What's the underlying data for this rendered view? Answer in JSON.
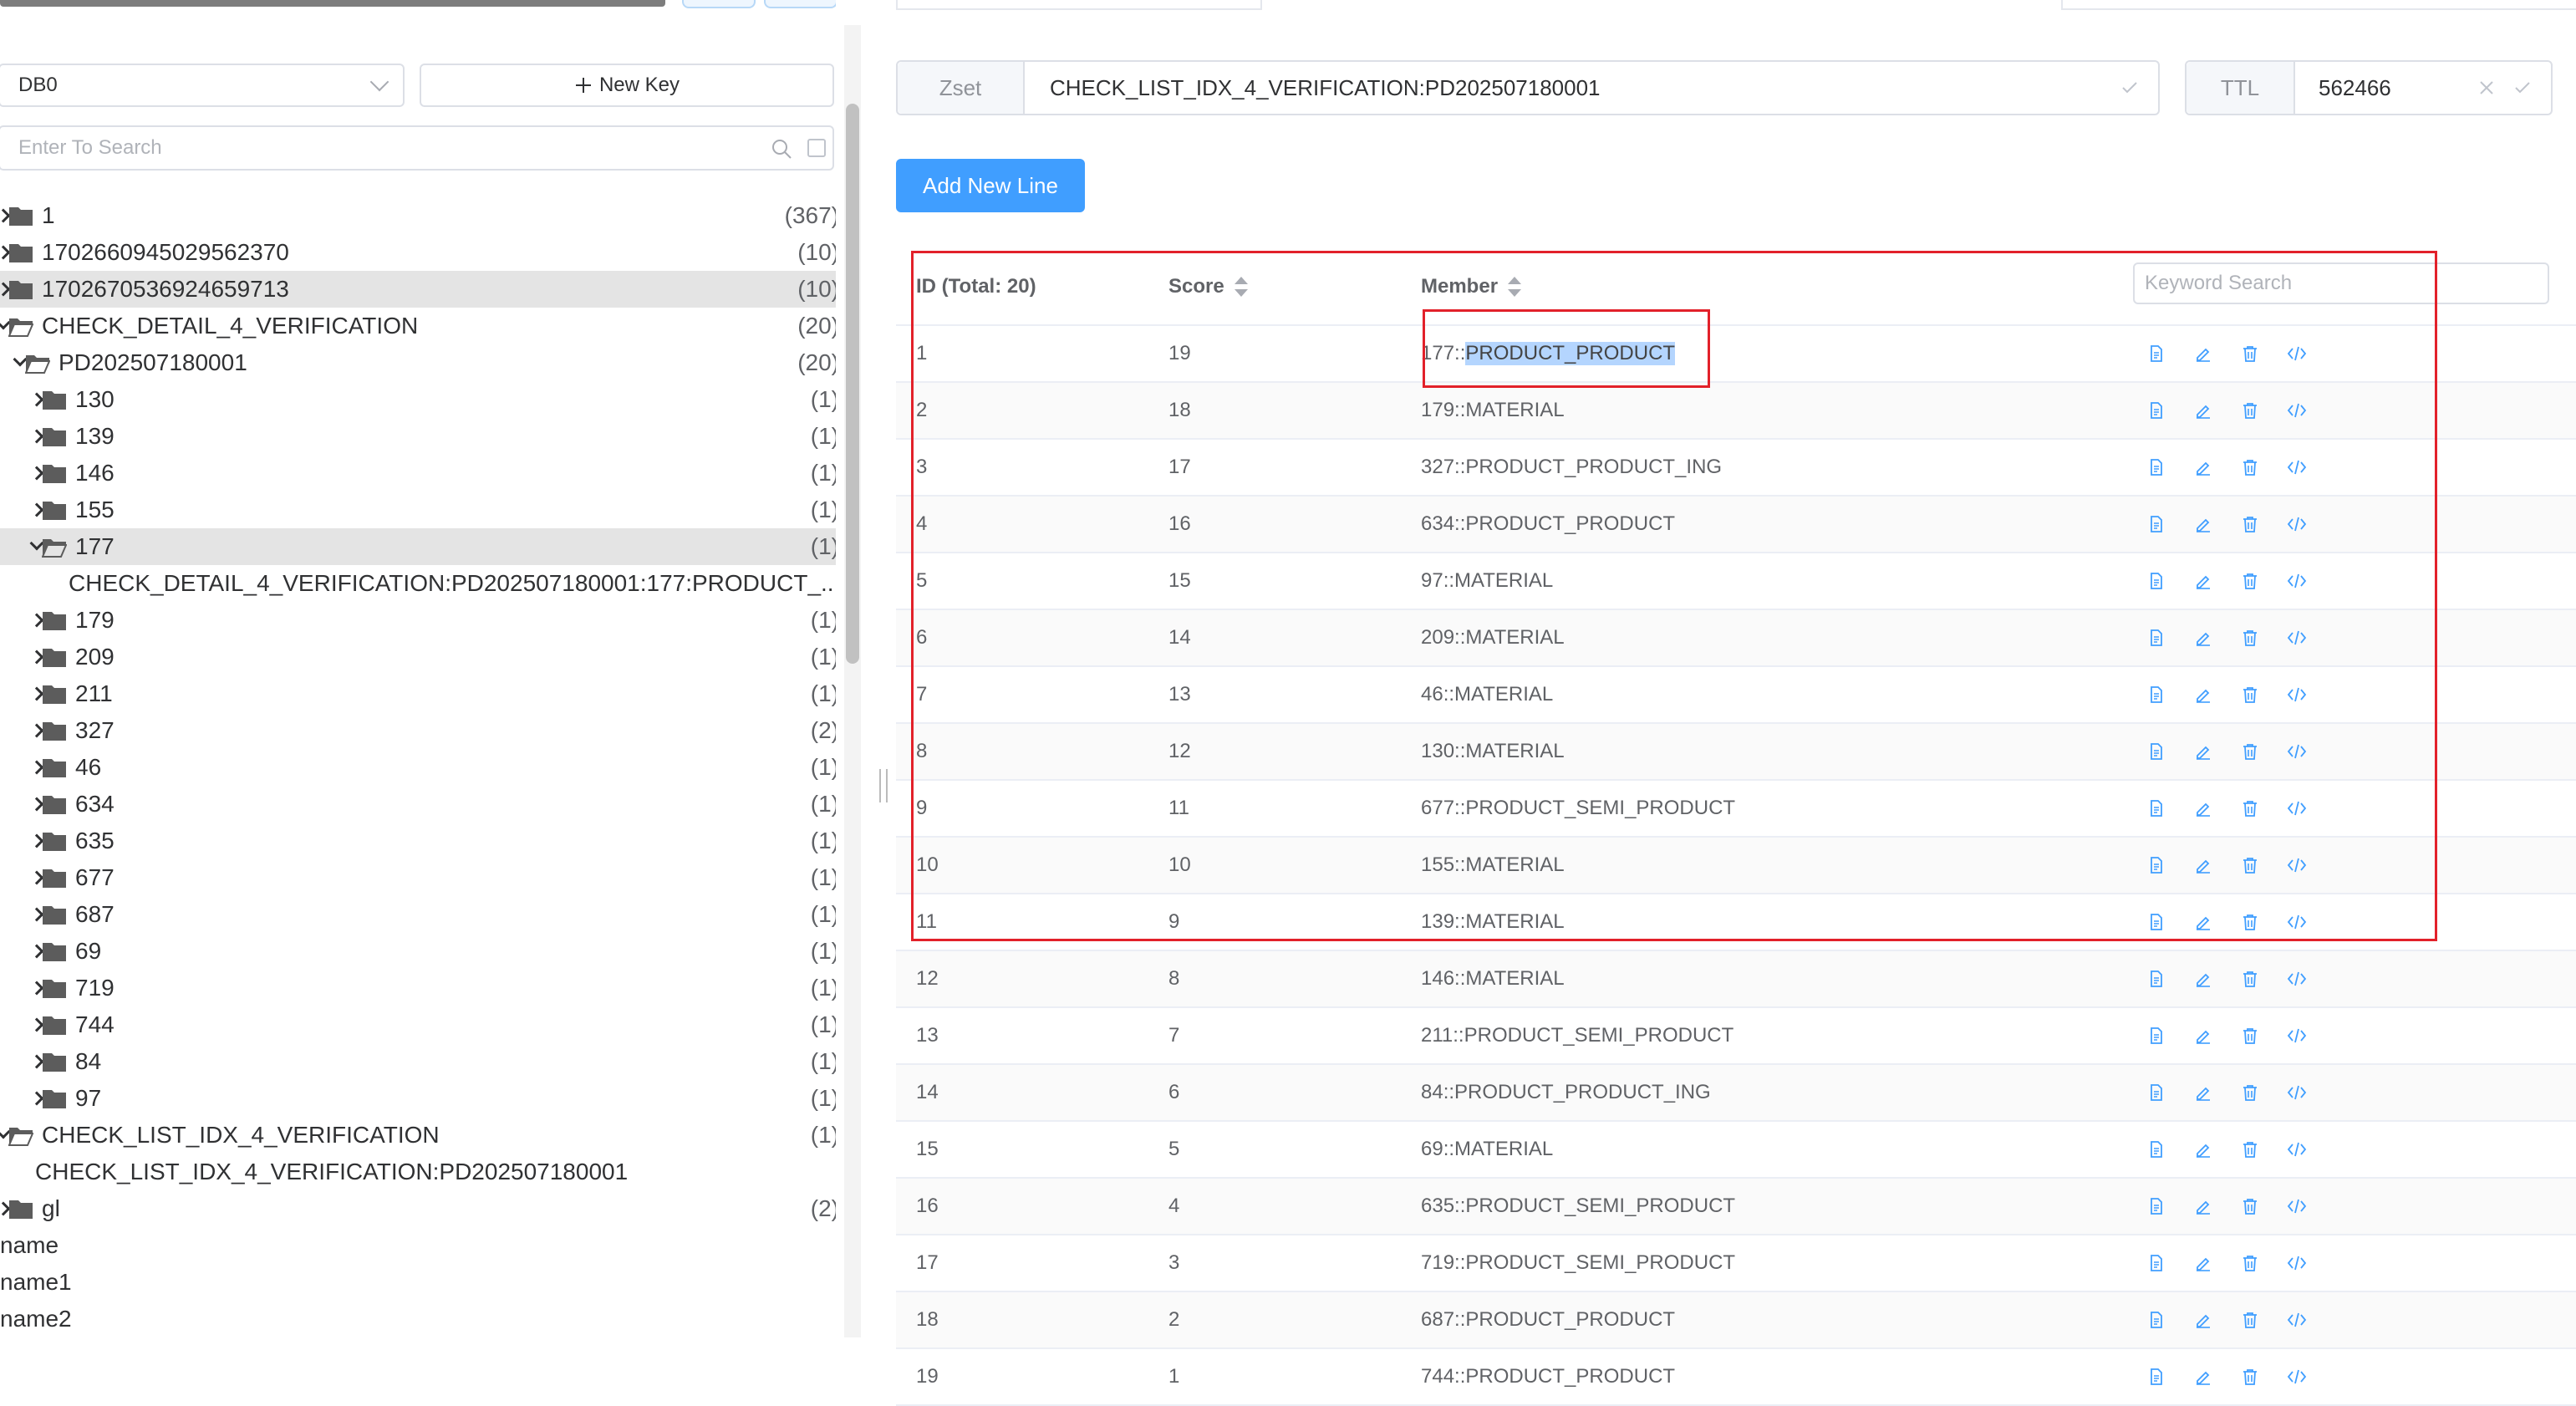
{
  "sidebar": {
    "db_select": "DB0",
    "new_key_label": "New Key",
    "search_placeholder": "Enter To Search",
    "tree": [
      {
        "label": "1",
        "count": "(367)",
        "level": 0,
        "kind": "folder",
        "state": "collapsed"
      },
      {
        "label": "1702660945029562370",
        "count": "(10)",
        "level": 0,
        "kind": "folder",
        "state": "collapsed"
      },
      {
        "label": "1702670536924659713",
        "count": "(10)",
        "level": 0,
        "kind": "folder",
        "state": "collapsed",
        "selected": true
      },
      {
        "label": "CHECK_DETAIL_4_VERIFICATION",
        "count": "(20)",
        "level": 0,
        "kind": "folder",
        "state": "expanded"
      },
      {
        "label": "PD202507180001",
        "count": "(20)",
        "level": 1,
        "kind": "folder",
        "state": "expanded"
      },
      {
        "label": "130",
        "count": "(1)",
        "level": 2,
        "kind": "folder",
        "state": "collapsed"
      },
      {
        "label": "139",
        "count": "(1)",
        "level": 2,
        "kind": "folder",
        "state": "collapsed"
      },
      {
        "label": "146",
        "count": "(1)",
        "level": 2,
        "kind": "folder",
        "state": "collapsed"
      },
      {
        "label": "155",
        "count": "(1)",
        "level": 2,
        "kind": "folder",
        "state": "collapsed"
      },
      {
        "label": "177",
        "count": "(1)",
        "level": 2,
        "kind": "folder",
        "state": "expanded",
        "selected": true
      },
      {
        "label": "CHECK_DETAIL_4_VERIFICATION:PD202507180001:177:PRODUCT_...",
        "count": "",
        "level": 3,
        "kind": "key"
      },
      {
        "label": "179",
        "count": "(1)",
        "level": 2,
        "kind": "folder",
        "state": "collapsed"
      },
      {
        "label": "209",
        "count": "(1)",
        "level": 2,
        "kind": "folder",
        "state": "collapsed"
      },
      {
        "label": "211",
        "count": "(1)",
        "level": 2,
        "kind": "folder",
        "state": "collapsed"
      },
      {
        "label": "327",
        "count": "(2)",
        "level": 2,
        "kind": "folder",
        "state": "collapsed"
      },
      {
        "label": "46",
        "count": "(1)",
        "level": 2,
        "kind": "folder",
        "state": "collapsed"
      },
      {
        "label": "634",
        "count": "(1)",
        "level": 2,
        "kind": "folder",
        "state": "collapsed"
      },
      {
        "label": "635",
        "count": "(1)",
        "level": 2,
        "kind": "folder",
        "state": "collapsed"
      },
      {
        "label": "677",
        "count": "(1)",
        "level": 2,
        "kind": "folder",
        "state": "collapsed"
      },
      {
        "label": "687",
        "count": "(1)",
        "level": 2,
        "kind": "folder",
        "state": "collapsed"
      },
      {
        "label": "69",
        "count": "(1)",
        "level": 2,
        "kind": "folder",
        "state": "collapsed"
      },
      {
        "label": "719",
        "count": "(1)",
        "level": 2,
        "kind": "folder",
        "state": "collapsed"
      },
      {
        "label": "744",
        "count": "(1)",
        "level": 2,
        "kind": "folder",
        "state": "collapsed"
      },
      {
        "label": "84",
        "count": "(1)",
        "level": 2,
        "kind": "folder",
        "state": "collapsed"
      },
      {
        "label": "97",
        "count": "(1)",
        "level": 2,
        "kind": "folder",
        "state": "collapsed"
      },
      {
        "label": "CHECK_LIST_IDX_4_VERIFICATION",
        "count": "(1)",
        "level": 0,
        "kind": "folder",
        "state": "expanded"
      },
      {
        "label": "CHECK_LIST_IDX_4_VERIFICATION:PD202507180001",
        "count": "",
        "level": 1,
        "kind": "key"
      },
      {
        "label": "gl",
        "count": "(2)",
        "level": 0,
        "kind": "folder",
        "state": "collapsed"
      },
      {
        "label": "name",
        "count": "",
        "level": 0,
        "kind": "plain"
      },
      {
        "label": "name1",
        "count": "",
        "level": 0,
        "kind": "plain"
      },
      {
        "label": "name2",
        "count": "",
        "level": 0,
        "kind": "plain"
      }
    ]
  },
  "key_header": {
    "type": "Zset",
    "name": "CHECK_LIST_IDX_4_VERIFICATION:PD202507180001",
    "ttl_label": "TTL",
    "ttl_value": "562466"
  },
  "add_line_label": "Add New Line",
  "table": {
    "col_id": "ID (Total: 20)",
    "col_score": "Score",
    "col_member": "Member",
    "keyword_placeholder": "Keyword Search",
    "rows": [
      {
        "id": "1",
        "score": "19",
        "member_prefix": "177::",
        "member_highlight": "PRODUCT_PRODUCT"
      },
      {
        "id": "2",
        "score": "18",
        "member_prefix": "179::MATERIAL",
        "member_highlight": ""
      },
      {
        "id": "3",
        "score": "17",
        "member_prefix": "327::PRODUCT_PRODUCT_ING",
        "member_highlight": ""
      },
      {
        "id": "4",
        "score": "16",
        "member_prefix": "634::PRODUCT_PRODUCT",
        "member_highlight": ""
      },
      {
        "id": "5",
        "score": "15",
        "member_prefix": "97::MATERIAL",
        "member_highlight": ""
      },
      {
        "id": "6",
        "score": "14",
        "member_prefix": "209::MATERIAL",
        "member_highlight": ""
      },
      {
        "id": "7",
        "score": "13",
        "member_prefix": "46::MATERIAL",
        "member_highlight": ""
      },
      {
        "id": "8",
        "score": "12",
        "member_prefix": "130::MATERIAL",
        "member_highlight": ""
      },
      {
        "id": "9",
        "score": "11",
        "member_prefix": "677::PRODUCT_SEMI_PRODUCT",
        "member_highlight": ""
      },
      {
        "id": "10",
        "score": "10",
        "member_prefix": "155::MATERIAL",
        "member_highlight": ""
      },
      {
        "id": "11",
        "score": "9",
        "member_prefix": "139::MATERIAL",
        "member_highlight": ""
      },
      {
        "id": "12",
        "score": "8",
        "member_prefix": "146::MATERIAL",
        "member_highlight": ""
      },
      {
        "id": "13",
        "score": "7",
        "member_prefix": "211::PRODUCT_SEMI_PRODUCT",
        "member_highlight": ""
      },
      {
        "id": "14",
        "score": "6",
        "member_prefix": "84::PRODUCT_PRODUCT_ING",
        "member_highlight": ""
      },
      {
        "id": "15",
        "score": "5",
        "member_prefix": "69::MATERIAL",
        "member_highlight": ""
      },
      {
        "id": "16",
        "score": "4",
        "member_prefix": "635::PRODUCT_SEMI_PRODUCT",
        "member_highlight": ""
      },
      {
        "id": "17",
        "score": "3",
        "member_prefix": "719::PRODUCT_SEMI_PRODUCT",
        "member_highlight": ""
      },
      {
        "id": "18",
        "score": "2",
        "member_prefix": "687::PRODUCT_PRODUCT",
        "member_highlight": ""
      },
      {
        "id": "19",
        "score": "1",
        "member_prefix": "744::PRODUCT_PRODUCT",
        "member_highlight": ""
      }
    ],
    "row_actions": [
      "view-icon",
      "edit-icon",
      "delete-icon",
      "code-icon"
    ]
  },
  "colors": {
    "accent": "#409eff",
    "annotation_red": "#e2212a",
    "selection_highlight": "#b4d5fe",
    "selected_row": "#e4e4e4"
  }
}
